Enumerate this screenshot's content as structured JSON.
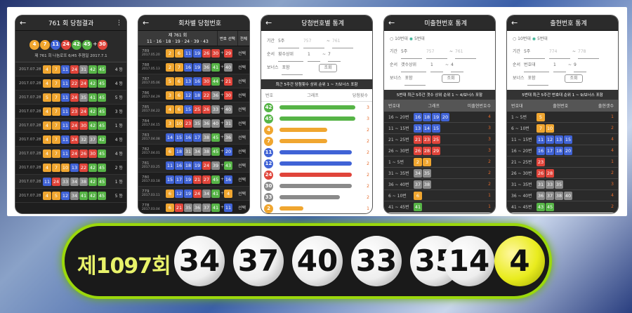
{
  "p1": {
    "title": "761 회 당첨결과",
    "draw_balls": [
      "4",
      "7",
      "11",
      "24",
      "42",
      "45",
      "30"
    ],
    "plus": "+",
    "summary": "제 761 회 나눔로또 6/45 추첨일 2017.7.1",
    "rows": [
      {
        "date": "2017.07.28",
        "balls": [
          "4",
          "7",
          "11",
          "24",
          "31",
          "42",
          "45"
        ],
        "rank": "4 등"
      },
      {
        "date": "2017.07.28",
        "balls": [
          "4",
          "7",
          "11",
          "22",
          "24",
          "42",
          "45"
        ],
        "rank": "4 등"
      },
      {
        "date": "2017.07.28",
        "balls": [
          "5",
          "7",
          "11",
          "24",
          "35",
          "41",
          "45"
        ],
        "rank": "5 등"
      },
      {
        "date": "2017.07.28",
        "balls": [
          "4",
          "7",
          "11",
          "23",
          "24",
          "42",
          "45"
        ],
        "rank": "3 등"
      },
      {
        "date": "2017.07.28",
        "balls": [
          "4",
          "7",
          "11",
          "24",
          "30",
          "42",
          "45"
        ],
        "rank": "1 등"
      },
      {
        "date": "2017.07.28",
        "balls": [
          "4",
          "7",
          "11",
          "24",
          "32",
          "37",
          "42"
        ],
        "rank": "4 등"
      },
      {
        "date": "2017.07.28",
        "balls": [
          "4",
          "7",
          "11",
          "24",
          "26",
          "30",
          "45"
        ],
        "rank": "4 등"
      },
      {
        "date": "2017.07.28",
        "balls": [
          "4",
          "7",
          "10",
          "13",
          "22",
          "42",
          "45"
        ],
        "rank": "2 등"
      },
      {
        "date": "2017.07.28",
        "balls": [
          "11",
          "24",
          "33",
          "34",
          "38",
          "42",
          "45"
        ],
        "rank": "1 등"
      },
      {
        "date": "2017.07.28",
        "balls": [
          "4",
          "5",
          "12",
          "34",
          "41",
          "42",
          "45"
        ],
        "rank": "5 등"
      }
    ]
  },
  "p2": {
    "title": "회차별 당첨번호",
    "head": "제 761 회",
    "head_nums": "11 · 16 · 18 · 19 · 24 · 39 · 43",
    "btn1": "번호 선택",
    "btn2": "전체",
    "rows": [
      {
        "no": "789",
        "date": "2017.05.20",
        "nums": [
          "2",
          "6",
          "11",
          "19",
          "26",
          "30"
        ],
        "b": "29",
        "t": "선택"
      },
      {
        "no": "788",
        "date": "2017.05.13",
        "nums": [
          "2",
          "7",
          "16",
          "19",
          "36",
          "41"
        ],
        "b": "40",
        "t": "선택"
      },
      {
        "no": "787",
        "date": "2017.05.06",
        "nums": [
          "5",
          "6",
          "13",
          "16",
          "30",
          "44"
        ],
        "b": "21",
        "t": "선택"
      },
      {
        "no": "786",
        "date": "2017.04.29",
        "nums": [
          "3",
          "6",
          "12",
          "18",
          "22",
          "36"
        ],
        "b": "30",
        "t": "선택"
      },
      {
        "no": "785",
        "date": "2017.04.22",
        "nums": [
          "4",
          "6",
          "15",
          "25",
          "26",
          "33"
        ],
        "b": "40",
        "t": "선택"
      },
      {
        "no": "784",
        "date": "2017.04.15",
        "nums": [
          "3",
          "10",
          "23",
          "35",
          "36",
          "40"
        ],
        "b": "31",
        "t": "선택"
      },
      {
        "no": "783",
        "date": "2017.04.08",
        "nums": [
          "14",
          "15",
          "16",
          "17",
          "38",
          "45"
        ],
        "b": "36",
        "t": "선택"
      },
      {
        "no": "782",
        "date": "2017.04.01",
        "nums": [
          "6",
          "18",
          "31",
          "34",
          "38",
          "45"
        ],
        "b": "20",
        "t": "선택"
      },
      {
        "no": "781",
        "date": "2017.03.25",
        "nums": [
          "11",
          "16",
          "18",
          "19",
          "24",
          "39"
        ],
        "b": "43",
        "t": "선택"
      },
      {
        "no": "780",
        "date": "2017.03.18",
        "nums": [
          "15",
          "17",
          "19",
          "21",
          "27",
          "45"
        ],
        "b": "16",
        "t": "선택"
      },
      {
        "no": "779",
        "date": "2017.03.11",
        "nums": [
          "6",
          "12",
          "19",
          "24",
          "34",
          "41"
        ],
        "b": "4",
        "t": "선택"
      },
      {
        "no": "778",
        "date": "2017.03.04",
        "nums": [
          "6",
          "21",
          "35",
          "36",
          "37",
          "41"
        ],
        "b": "11",
        "t": "선택"
      },
      {
        "no": "777",
        "date": "2017.02.25",
        "nums": [
          "6",
          "12",
          "17",
          "21",
          "32",
          "39"
        ],
        "b": "30",
        "t": "선택"
      },
      {
        "no": "776",
        "date": "2017.02.18",
        "nums": [
          "8",
          "13",
          "18",
          "24",
          "27",
          "29"
        ],
        "b": "17",
        "t": "선택"
      }
    ]
  },
  "p3": {
    "title": "당첨번호별 통계",
    "f1": "기간",
    "f1v": "5주",
    "f1a": "757",
    "f1b": "761",
    "f2": "순서",
    "f2v": "횟수상위",
    "f2a": "1",
    "f2b": "7",
    "f3": "보너스",
    "f3v": "포함",
    "btn": "조회",
    "hdr": "최근 5주간 당첨횟수 상위 순위 1 ~ 7/보너스 포함",
    "cols": [
      "번호",
      "그래프",
      "당첨횟수"
    ],
    "rows": [
      {
        "n": "42",
        "c": "gr",
        "w": 0.95,
        "cnt": "3"
      },
      {
        "n": "45",
        "c": "gr",
        "w": 0.95,
        "cnt": "3"
      },
      {
        "n": "4",
        "c": "y",
        "w": 0.6,
        "cnt": "2"
      },
      {
        "n": "7",
        "c": "y",
        "w": 0.6,
        "cnt": "2"
      },
      {
        "n": "11",
        "c": "b",
        "w": 0.9,
        "cnt": "2"
      },
      {
        "n": "12",
        "c": "b",
        "w": 0.9,
        "cnt": "2"
      },
      {
        "n": "24",
        "c": "r",
        "w": 0.9,
        "cnt": "2"
      },
      {
        "n": "30",
        "c": "g",
        "w": 0.9,
        "cnt": "2"
      },
      {
        "n": "33",
        "c": "g",
        "w": 0.75,
        "cnt": "2"
      },
      {
        "n": "2",
        "c": "y",
        "w": 0.3,
        "cnt": "1"
      }
    ]
  },
  "p4": {
    "title": "미출현번호 통계",
    "opt1": "10번대",
    "opt2": "5번대",
    "f1": "기간",
    "f1v": "5주",
    "f1a": "757",
    "f1b": "761",
    "f2": "순서",
    "f2v": "갯수상위",
    "f2a": "1",
    "f2b": "4",
    "f3": "보너스",
    "f3v": "포함",
    "btn": "조회",
    "hdr": "5번대 최근 5주간 갯수 상위 순위 1 ~ 4/보너스 포함",
    "cols": [
      "번호대",
      "그래프",
      "미출현번호수"
    ],
    "rows": [
      {
        "rg": "16 ~ 20번",
        "nums": [
          "16",
          "18",
          "19",
          "20"
        ],
        "c": "b",
        "cnt": "4"
      },
      {
        "rg": "11 ~ 15번",
        "nums": [
          "13",
          "14",
          "15"
        ],
        "c": "b",
        "cnt": "3"
      },
      {
        "rg": "21 ~ 25번",
        "nums": [
          "21",
          "23",
          "25"
        ],
        "c": "r",
        "cnt": "3"
      },
      {
        "rg": "26 ~ 30번",
        "nums": [
          "26",
          "28",
          "29"
        ],
        "c": "r",
        "cnt": "3"
      },
      {
        "rg": "1 ~ 5번",
        "nums": [
          "2",
          "3"
        ],
        "c": "y",
        "cnt": "2"
      },
      {
        "rg": "31 ~ 35번",
        "nums": [
          "34",
          "35"
        ],
        "c": "g",
        "cnt": "2"
      },
      {
        "rg": "36 ~ 40번",
        "nums": [
          "37",
          "38"
        ],
        "c": "g",
        "cnt": "2"
      },
      {
        "rg": "6 ~ 10번",
        "nums": [
          "6"
        ],
        "c": "y",
        "cnt": "1"
      },
      {
        "rg": "41 ~ 45번",
        "nums": [
          "41"
        ],
        "c": "gr",
        "cnt": "1"
      }
    ]
  },
  "p5": {
    "title": "출현번호 통계",
    "opt1": "10번대",
    "opt2": "5번대",
    "f1": "기간",
    "f1v": "5주",
    "f1a": "774",
    "f1b": "778",
    "f2": "순서",
    "f2v": "번호대",
    "f2a": "1",
    "f2b": "9",
    "f3": "보너스",
    "f3v": "포함",
    "btn": "조회",
    "hdr": "5번대 최근 5주간 번호대 순위 1 ~ 9/보너스 포함",
    "cols": [
      "번호대",
      "출현번호",
      "출현갯수"
    ],
    "rows": [
      {
        "rg": "1 ~ 5번",
        "nums": [
          "5"
        ],
        "c": "y",
        "cnt": "1"
      },
      {
        "rg": "6 ~ 10번",
        "nums": [
          "7",
          "10"
        ],
        "c": "y",
        "cnt": "2"
      },
      {
        "rg": "11 ~ 15번",
        "nums": [
          "11",
          "12",
          "13",
          "15"
        ],
        "c": "b",
        "cnt": "4"
      },
      {
        "rg": "16 ~ 20번",
        "nums": [
          "16",
          "17",
          "18",
          "20"
        ],
        "c": "b",
        "cnt": "4"
      },
      {
        "rg": "21 ~ 25번",
        "nums": [
          "23"
        ],
        "c": "r",
        "cnt": "1"
      },
      {
        "rg": "26 ~ 30번",
        "nums": [
          "26",
          "28"
        ],
        "c": "r",
        "cnt": "2"
      },
      {
        "rg": "31 ~ 35번",
        "nums": [
          "31",
          "33",
          "35"
        ],
        "c": "g",
        "cnt": "3"
      },
      {
        "rg": "36 ~ 40번",
        "nums": [
          "36",
          "37",
          "38",
          "40"
        ],
        "c": "g",
        "cnt": "4"
      },
      {
        "rg": "41 ~ 45번",
        "nums": [
          "43",
          "45"
        ],
        "c": "gr",
        "cnt": "2"
      }
    ]
  },
  "banner": {
    "episode": "제1097회",
    "numbers": [
      "34",
      "37",
      "40",
      "33",
      "35",
      "14"
    ],
    "bonus": "4"
  },
  "colors": {
    "accent": "#9bd80c",
    "y": "#f0a630",
    "b": "#4063d6",
    "r": "#e0443a",
    "g": "#8a8a8a",
    "gr": "#56b446"
  }
}
